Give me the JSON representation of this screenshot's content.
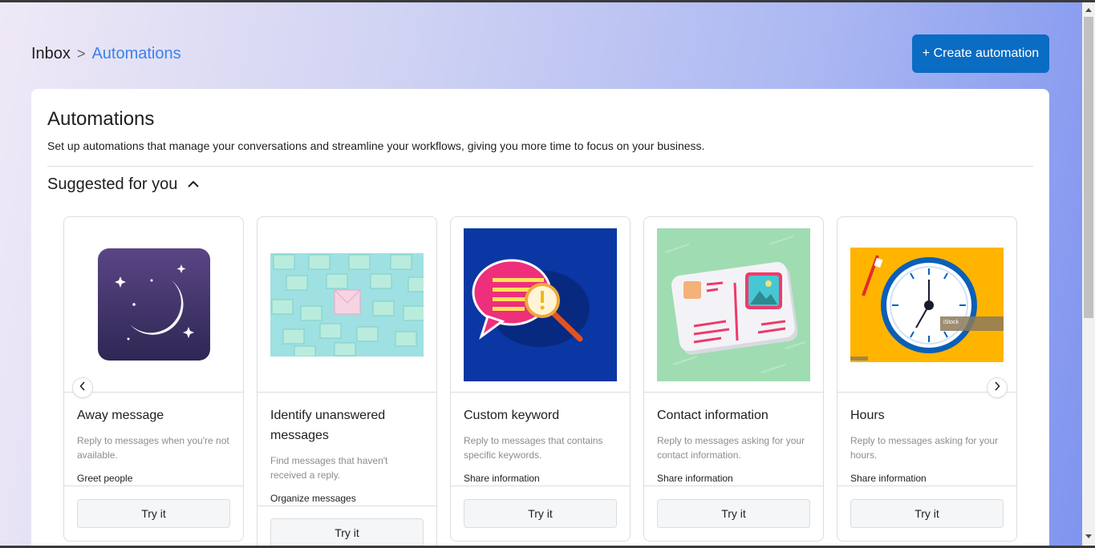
{
  "breadcrumb": {
    "root": "Inbox",
    "separator": ">",
    "current": "Automations"
  },
  "header": {
    "create_button": "+ Create automation"
  },
  "panel": {
    "title": "Automations",
    "description": "Set up automations that manage your conversations and streamline your workflows, giving you more time to focus on your business.",
    "section_title": "Suggested for you"
  },
  "cards": [
    {
      "title": "Away message",
      "description": "Reply to messages when you're not available.",
      "category": "Greet people",
      "button": "Try it",
      "image": "moon-night-illustration"
    },
    {
      "title": "Identify unanswered messages",
      "description": "Find messages that haven't received a reply.",
      "category": "Organize messages",
      "button": "Try it",
      "image": "envelopes-illustration"
    },
    {
      "title": "Custom keyword",
      "description": "Reply to messages that contains specific keywords.",
      "category": "Share information",
      "button": "Try it",
      "image": "speech-bubble-magnifier-illustration"
    },
    {
      "title": "Contact information",
      "description": "Reply to messages asking for your contact information.",
      "category": "Share information",
      "button": "Try it",
      "image": "postcard-illustration"
    },
    {
      "title": "Hours",
      "description": "Reply to messages asking for your hours.",
      "category": "Share information",
      "button": "Try it",
      "image": "clock-illustration",
      "watermark": "iStock"
    }
  ],
  "colors": {
    "primary_button": "#0a6cc2",
    "breadcrumb_link": "#3b82e8"
  }
}
